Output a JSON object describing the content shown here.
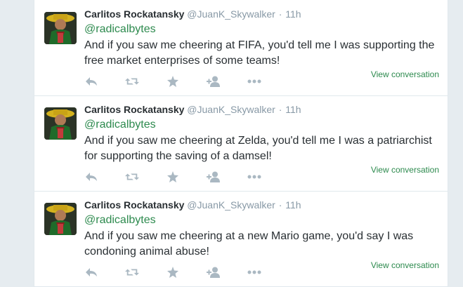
{
  "colors": {
    "link": "#2d8a4e",
    "icon": "#aab8c2",
    "name": "#292f33",
    "meta": "#8899a6"
  },
  "icons": [
    "reply-icon",
    "retweet-icon",
    "favorite-icon",
    "follow-icon",
    "more-icon"
  ],
  "tweets": [
    {
      "fullname": "Carlitos Rockatansky",
      "handle": "@JuanK_Skywalker",
      "separator": "·",
      "time": "11h",
      "mention": "@radicalbytes",
      "text": "And if you saw me cheering at FIFA, you'd tell me I was supporting the free market enterprises of some teams!",
      "view_conversation": "View conversation"
    },
    {
      "fullname": "Carlitos Rockatansky",
      "handle": "@JuanK_Skywalker",
      "separator": "·",
      "time": "11h",
      "mention": "@radicalbytes",
      "text": "And if you saw me cheering at Zelda, you'd tell me I was a patriarchist for supporting the saving of a damsel!",
      "view_conversation": "View conversation"
    },
    {
      "fullname": "Carlitos Rockatansky",
      "handle": "@JuanK_Skywalker",
      "separator": "·",
      "time": "11h",
      "mention": "@radicalbytes",
      "text": "And if you saw me cheering at a new Mario game, you'd say I was condoning animal abuse!",
      "view_conversation": "View conversation"
    }
  ]
}
